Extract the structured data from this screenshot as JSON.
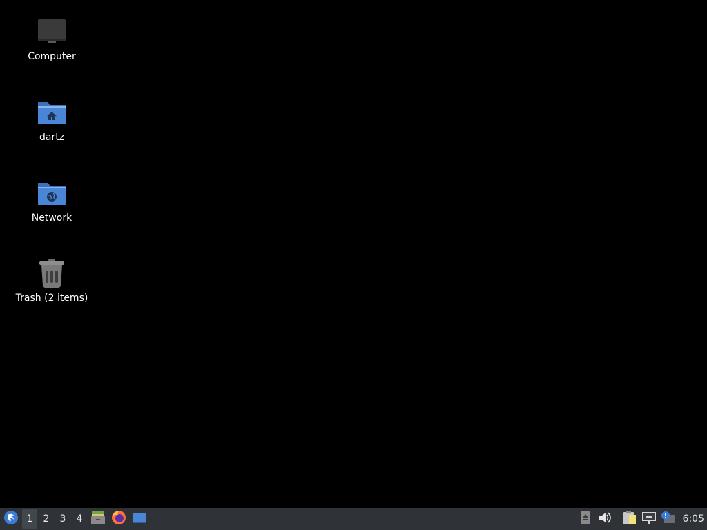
{
  "desktop": {
    "icons": [
      {
        "label": "Computer",
        "icon": "computer-icon"
      },
      {
        "label": "dartz",
        "icon": "home-folder-icon"
      },
      {
        "label": "Network",
        "icon": "network-folder-icon"
      },
      {
        "label": "Trash (2 items)",
        "icon": "trash-icon"
      }
    ]
  },
  "panel": {
    "menu_icon": "start-menu-icon",
    "workspaces": [
      "1",
      "2",
      "3",
      "4"
    ],
    "active_workspace": "1",
    "launchers": [
      {
        "icon": "file-manager-icon"
      },
      {
        "icon": "firefox-icon"
      },
      {
        "icon": "show-desktop-icon"
      }
    ],
    "tray": [
      {
        "icon": "eject-icon"
      },
      {
        "icon": "volume-icon"
      },
      {
        "icon": "clipboard-icon"
      },
      {
        "icon": "network-wired-icon"
      },
      {
        "icon": "update-notifier-icon"
      }
    ],
    "clock": "6:05"
  },
  "colors": {
    "desktop_bg": "#000000",
    "panel_bg": "#2f3237",
    "folder_blue": "#4a86d6",
    "selection_underline": "#3d6cc2"
  }
}
